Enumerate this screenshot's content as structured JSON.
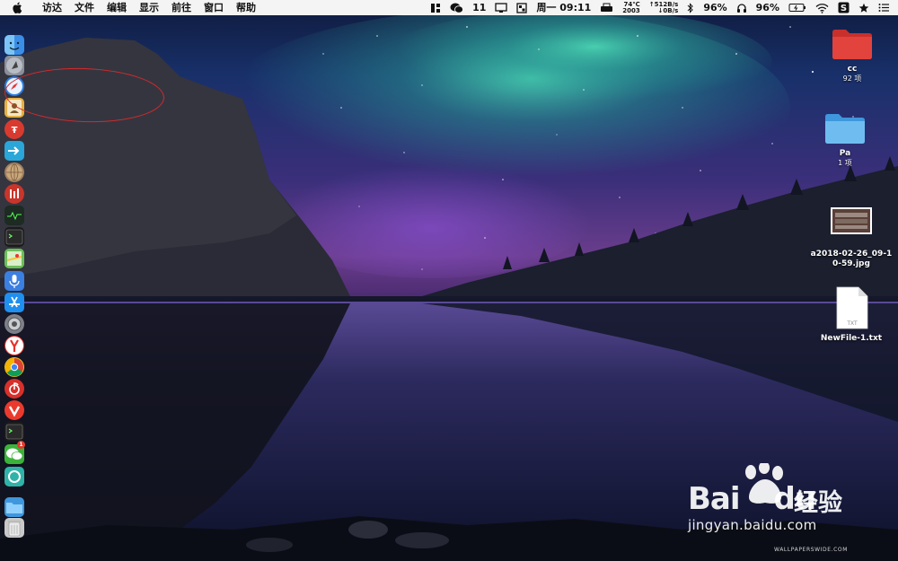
{
  "menubar": {
    "app_name": "访达",
    "items": [
      "文件",
      "编辑",
      "显示",
      "前往",
      "窗口",
      "帮助"
    ],
    "status": {
      "wechat_count": "11",
      "clock": "周一 09:11",
      "cpu_temp": "74℃",
      "fan_speed": "2003",
      "net_up": "↑512B/s",
      "net_down": "↓0B/s",
      "battery_pct_1": "96%",
      "battery_pct_2": "96%"
    }
  },
  "dock": {
    "apps": [
      {
        "name": "finder-icon",
        "color": "#3a8ee6"
      },
      {
        "name": "launchpad-icon",
        "color": "#8a8f99"
      },
      {
        "name": "safari-icon",
        "color": "#2d7de0"
      },
      {
        "name": "contacts-icon",
        "color": "#e6b044"
      },
      {
        "name": "app-red-ty-icon",
        "color": "#d93a2f"
      },
      {
        "name": "migration-arrow-icon",
        "color": "#2aa6d8"
      },
      {
        "name": "globe-icon",
        "color": "#a08060"
      },
      {
        "name": "app-red-bars-icon",
        "color": "#c8352b"
      },
      {
        "name": "activity-monitor-icon",
        "color": "#1d2b22"
      },
      {
        "name": "terminal-icon",
        "color": "#1b1b1b"
      },
      {
        "name": "maps-icon",
        "color": "#6cbf5a"
      },
      {
        "name": "siri-microphone-icon",
        "color": "#3b7fe0"
      },
      {
        "name": "app-store-icon",
        "color": "#1f8ff0"
      },
      {
        "name": "system-preferences-icon",
        "color": "#7d8088"
      },
      {
        "name": "yandex-browser-icon",
        "color": "#e8302b"
      },
      {
        "name": "chrome-icon",
        "color": "#f2c21b"
      },
      {
        "name": "netease-music-icon",
        "color": "#d8302a"
      },
      {
        "name": "vivaldi-icon",
        "color": "#ea3a2e"
      },
      {
        "name": "terminal-dollar-icon",
        "color": "#1b1b1b"
      },
      {
        "name": "wechat-icon",
        "color": "#3bb33a"
      },
      {
        "name": "app-teal-icon",
        "color": "#2fb3a8"
      },
      {
        "name": "folder-icon",
        "color": "#3f97dd"
      },
      {
        "name": "trash-icon",
        "color": "#c9c9c9"
      }
    ],
    "wechat_badge": "1"
  },
  "desktop": {
    "items": [
      {
        "name": "cc",
        "sub": "92 项",
        "kind": "folder",
        "color": "#e2433c"
      },
      {
        "name": "Pa",
        "sub": "1 项",
        "kind": "folder",
        "color": "#5fb3ec"
      },
      {
        "name_line1": "a2018-02-26_09-1",
        "name_line2": "0-59.jpg",
        "kind": "image"
      },
      {
        "name": "NewFile-1.txt",
        "kind": "text",
        "badge": "TXT"
      }
    ]
  },
  "watermark": {
    "wordmark": "Bai",
    "wordmark_tail": "du",
    "product": "经验",
    "url": "jingyan.baidu.com",
    "credit": "WALLPAPERSWIDE.COM"
  }
}
